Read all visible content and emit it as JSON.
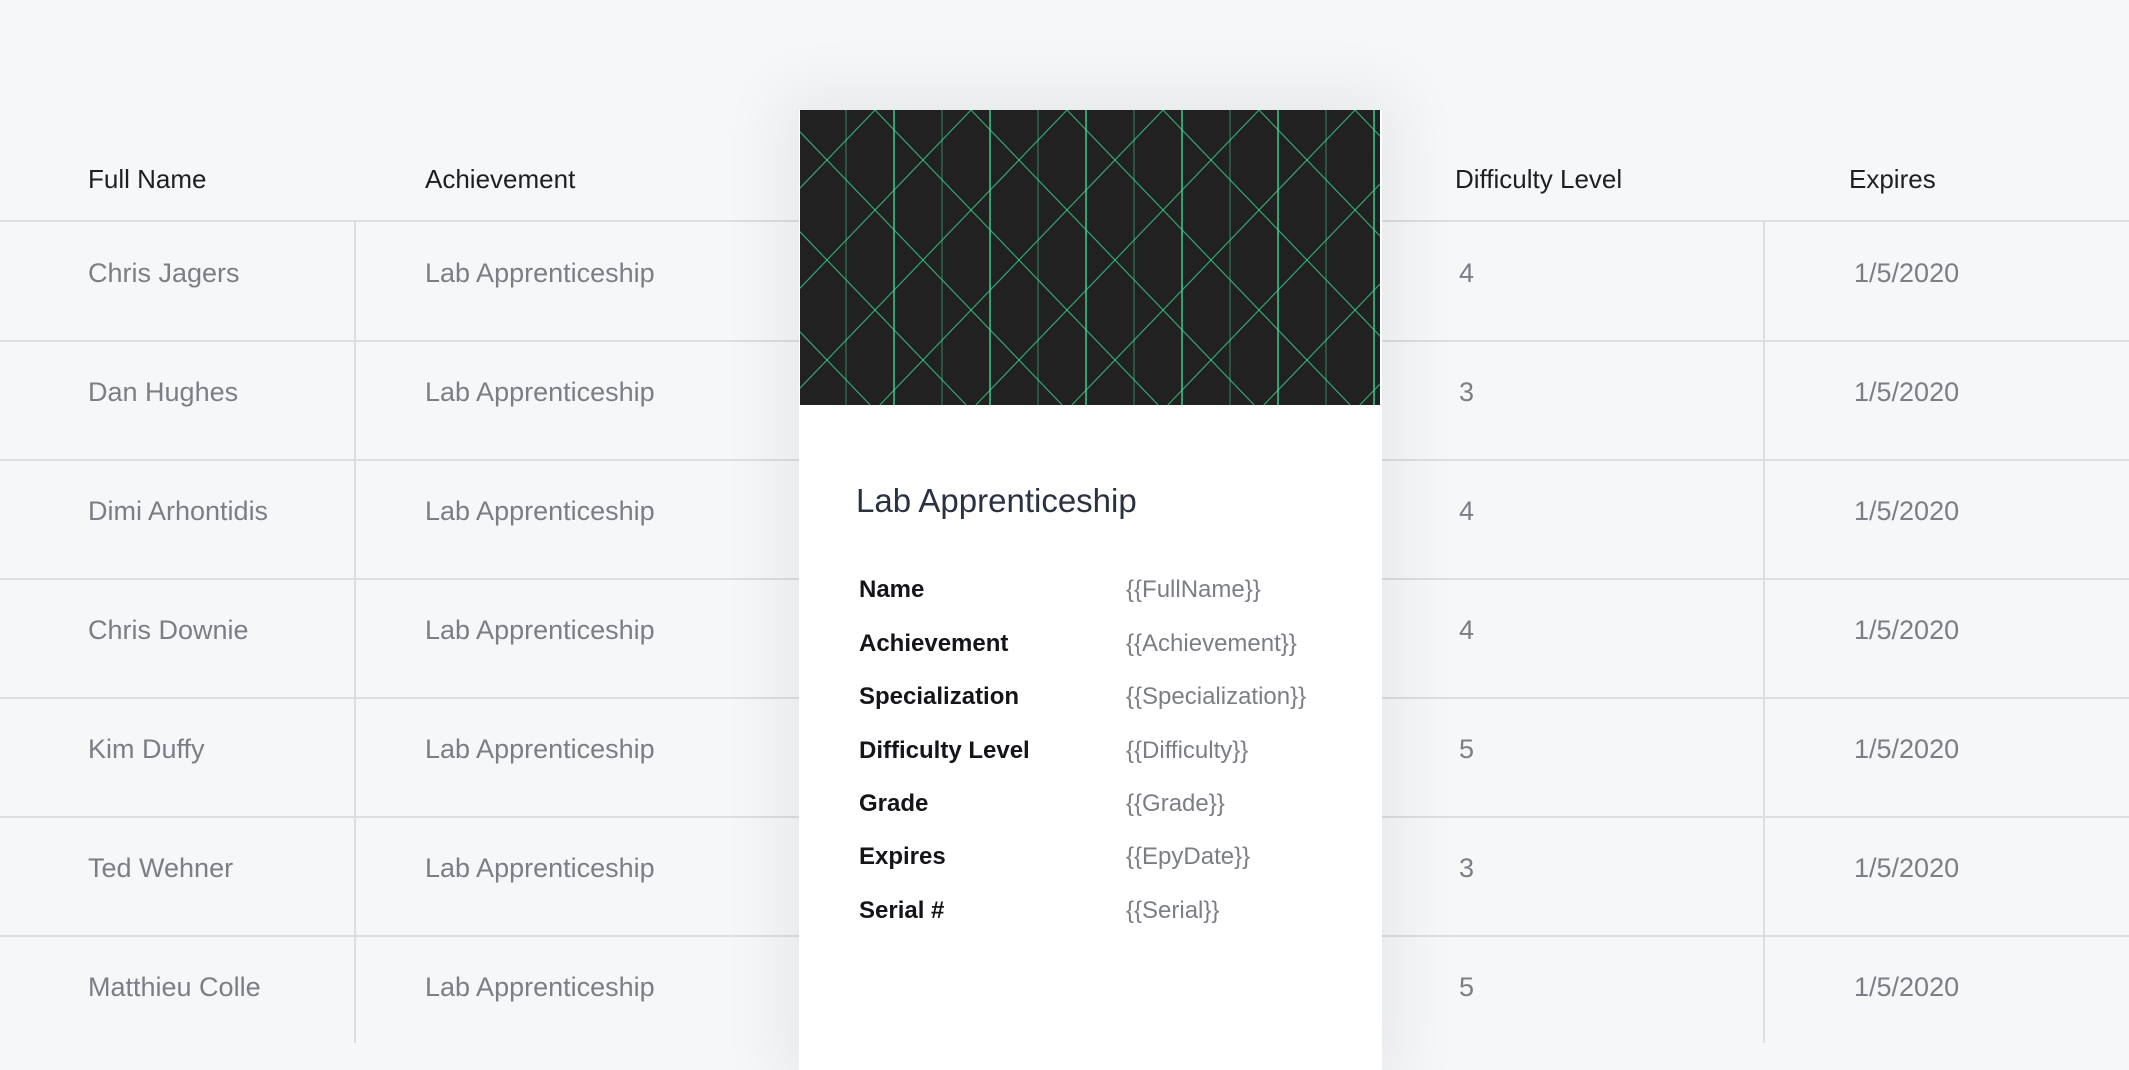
{
  "table": {
    "headers": {
      "full_name": "Full Name",
      "achievement": "Achievement",
      "difficulty": "Difficulty Level",
      "expires": "Expires"
    },
    "rows": [
      {
        "name": "Chris Jagers",
        "achievement": "Lab Apprenticeship",
        "difficulty": "4",
        "expires": "1/5/2020"
      },
      {
        "name": "Dan Hughes",
        "achievement": "Lab Apprenticeship",
        "difficulty": "3",
        "expires": "1/5/2020"
      },
      {
        "name": "Dimi Arhontidis",
        "achievement": "Lab Apprenticeship",
        "difficulty": "4",
        "expires": "1/5/2020"
      },
      {
        "name": "Chris Downie",
        "achievement": "Lab Apprenticeship",
        "difficulty": "4",
        "expires": "1/5/2020"
      },
      {
        "name": "Kim Duffy",
        "achievement": "Lab Apprenticeship",
        "difficulty": "5",
        "expires": "1/5/2020"
      },
      {
        "name": "Ted Wehner",
        "achievement": "Lab Apprenticeship",
        "difficulty": "3",
        "expires": "1/5/2020"
      },
      {
        "name": "Matthieu Colle",
        "achievement": "Lab Apprenticeship",
        "difficulty": "5",
        "expires": "1/5/2020"
      }
    ]
  },
  "card": {
    "title": "Lab Apprenticeship",
    "banner_colors": {
      "background": "#212121",
      "line": "#3ddc97"
    },
    "fields": [
      {
        "label": "Name",
        "value": "{{FullName}}"
      },
      {
        "label": "Achievement",
        "value": "{{Achievement}}"
      },
      {
        "label": "Specialization",
        "value": "{{Specialization}}"
      },
      {
        "label": "Difficulty Level",
        "value": "{{Difficulty}}"
      },
      {
        "label": "Grade",
        "value": "{{Grade}}"
      },
      {
        "label": "Expires",
        "value": "{{EpyDate}}"
      },
      {
        "label": "Serial #",
        "value": "{{Serial}}"
      }
    ]
  }
}
